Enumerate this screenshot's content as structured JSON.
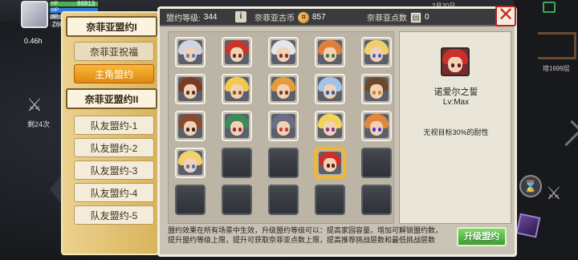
{
  "hud": {
    "gold": "86813",
    "hp_label": "HP",
    "mp_label": "MP",
    "sp_label": "SP",
    "level_badge": "Z60",
    "timer": "0.46h",
    "battle_count": "剩24次",
    "tower_floor": "塔1699层",
    "top_right": "2月20日"
  },
  "tabs": {
    "header1": "奈菲亚盟约I",
    "sub1": "奈菲亚祝福",
    "sub2": "主角盟约",
    "header2": "奈菲亚盟约II",
    "allies": [
      "队友盟约-1",
      "队友盟约-2",
      "队友盟约-3",
      "队友盟约-4",
      "队友盟约-5"
    ]
  },
  "stats": {
    "level_label": "盟约等级:",
    "level_value": "344",
    "coin_label": "奈菲亚古币",
    "coin_value": "857",
    "points_label": "奈菲亚点数",
    "points_value": "0"
  },
  "close_symbol": "✕",
  "heroes": [
    {
      "hair": "#cfd4e2",
      "eye": "#5a7fc2"
    },
    {
      "hair": "#c7352b",
      "eye": "#6a2a1b"
    },
    {
      "hair": "#e5e5ea",
      "eye": "#8b2b2b"
    },
    {
      "hair": "#e07f3c",
      "eye": "#3b7a44"
    },
    {
      "hair": "#f0d06a",
      "eye": "#3b6dc2"
    },
    {
      "hair": "#7a3a24",
      "eye": "#5b2f1e"
    },
    {
      "hair": "#f2c94c",
      "eye": "#8a5a1a"
    },
    {
      "hair": "#e49c3d",
      "eye": "#7a3b1a"
    },
    {
      "hair": "#9fc4e8",
      "eye": "#2c5f9b"
    },
    {
      "hair": "#6a4a2a",
      "eye": "#c68a1a"
    },
    {
      "hair": "#8a4a30",
      "eye": "#3a2418"
    },
    {
      "hair": "#3f8a5a",
      "eye": "#8a2a2a"
    },
    {
      "hair": "#6a6f86",
      "eye": "#c23a3a"
    },
    {
      "hair": "#f2d35a",
      "eye": "#7a3b8a"
    },
    {
      "hair": "#e2863a",
      "eye": "#4b3bc2"
    },
    {
      "hair": "#f2d06a",
      "eye": "#3b7ac2"
    },
    {
      "locked": true
    },
    {
      "locked": true
    },
    {
      "hair": "#c9302a",
      "eye": "#5b1a1a",
      "selected": true
    },
    {
      "locked": true
    },
    {
      "locked": true
    },
    {
      "locked": true
    },
    {
      "locked": true
    },
    {
      "locked": true
    },
    {
      "locked": true
    }
  ],
  "detail": {
    "name": "诺爱尔之誓",
    "level": "Lv:Max",
    "description": "无视目标30%的耐性"
  },
  "footer": {
    "text": "盟约效果在所有场景中生效，升级盟约等级可以：提高家园容量，增加可解锁盟约数，提升盟约等级上限，提升可获取奈菲亚点数上限，提高推荐挑战层数和最低挑战层数"
  },
  "upgrade_label": "升级盟约",
  "colors": {
    "active_tab": "#f0a020",
    "upgrade_green": "#4caf3a",
    "close_red": "#d4231d"
  }
}
